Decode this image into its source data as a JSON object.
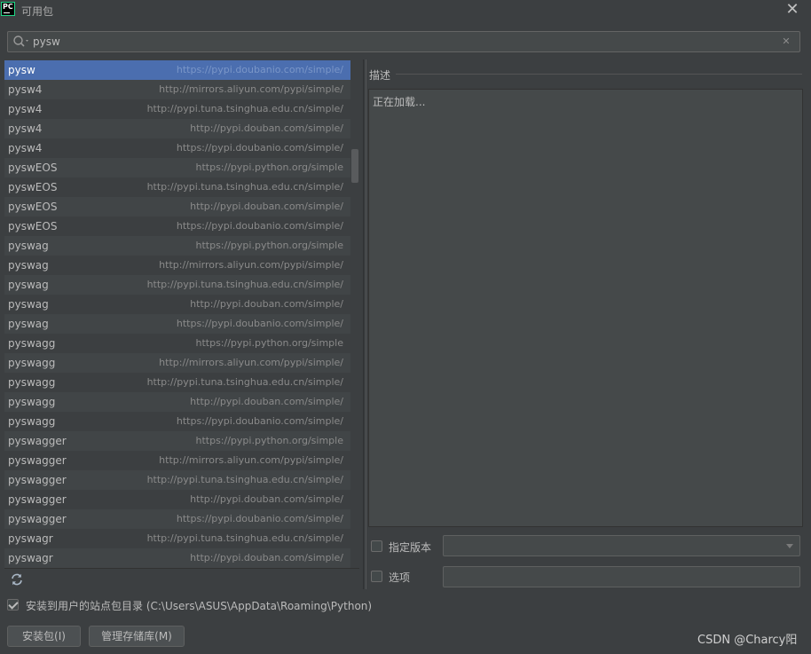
{
  "window": {
    "title": "可用包",
    "logo_text": "PC",
    "close_glyph": "✕"
  },
  "search": {
    "value": "pysw",
    "clear_glyph": "✕"
  },
  "packages": [
    {
      "name": "pysw",
      "repo": "https://pypi.doubanio.com/simple/",
      "selected": true
    },
    {
      "name": "pysw4",
      "repo": "http://mirrors.aliyun.com/pypi/simple/"
    },
    {
      "name": "pysw4",
      "repo": "http://pypi.tuna.tsinghua.edu.cn/simple/"
    },
    {
      "name": "pysw4",
      "repo": "http://pypi.douban.com/simple/"
    },
    {
      "name": "pysw4",
      "repo": "https://pypi.doubanio.com/simple/"
    },
    {
      "name": "pyswEOS",
      "repo": "https://pypi.python.org/simple"
    },
    {
      "name": "pyswEOS",
      "repo": "http://pypi.tuna.tsinghua.edu.cn/simple/"
    },
    {
      "name": "pyswEOS",
      "repo": "http://pypi.douban.com/simple/"
    },
    {
      "name": "pyswEOS",
      "repo": "https://pypi.doubanio.com/simple/"
    },
    {
      "name": "pyswag",
      "repo": "https://pypi.python.org/simple"
    },
    {
      "name": "pyswag",
      "repo": "http://mirrors.aliyun.com/pypi/simple/"
    },
    {
      "name": "pyswag",
      "repo": "http://pypi.tuna.tsinghua.edu.cn/simple/"
    },
    {
      "name": "pyswag",
      "repo": "http://pypi.douban.com/simple/"
    },
    {
      "name": "pyswag",
      "repo": "https://pypi.doubanio.com/simple/"
    },
    {
      "name": "pyswagg",
      "repo": "https://pypi.python.org/simple"
    },
    {
      "name": "pyswagg",
      "repo": "http://mirrors.aliyun.com/pypi/simple/"
    },
    {
      "name": "pyswagg",
      "repo": "http://pypi.tuna.tsinghua.edu.cn/simple/"
    },
    {
      "name": "pyswagg",
      "repo": "http://pypi.douban.com/simple/"
    },
    {
      "name": "pyswagg",
      "repo": "https://pypi.doubanio.com/simple/"
    },
    {
      "name": "pyswagger",
      "repo": "https://pypi.python.org/simple"
    },
    {
      "name": "pyswagger",
      "repo": "http://mirrors.aliyun.com/pypi/simple/"
    },
    {
      "name": "pyswagger",
      "repo": "http://pypi.tuna.tsinghua.edu.cn/simple/"
    },
    {
      "name": "pyswagger",
      "repo": "http://pypi.douban.com/simple/"
    },
    {
      "name": "pyswagger",
      "repo": "https://pypi.doubanio.com/simple/"
    },
    {
      "name": "pyswagr",
      "repo": "http://pypi.tuna.tsinghua.edu.cn/simple/"
    },
    {
      "name": "pyswagr",
      "repo": "http://pypi.douban.com/simple/"
    }
  ],
  "description": {
    "label": "描述",
    "text": "正在加载..."
  },
  "options": {
    "specify_version_label": "指定版本",
    "specify_version_checked": false,
    "options_label": "选项",
    "options_checked": false,
    "options_value": ""
  },
  "install_to_user": {
    "label": "安装到用户的站点包目录 (C:\\Users\\ASUS\\AppData\\Roaming\\Python)",
    "checked": true
  },
  "buttons": {
    "install": "安装包(I)",
    "manage_repos": "管理存储库(M)"
  },
  "watermark": "CSDN @Charcy阳",
  "colors": {
    "background": "#3c3f41",
    "selection": "#4b6eaf",
    "field": "#45494a",
    "text": "#bbbbbb"
  },
  "icons": {
    "search": "search-icon",
    "refresh": "refresh-icon",
    "close": "close-icon",
    "dropdown": "chevron-down-icon"
  }
}
